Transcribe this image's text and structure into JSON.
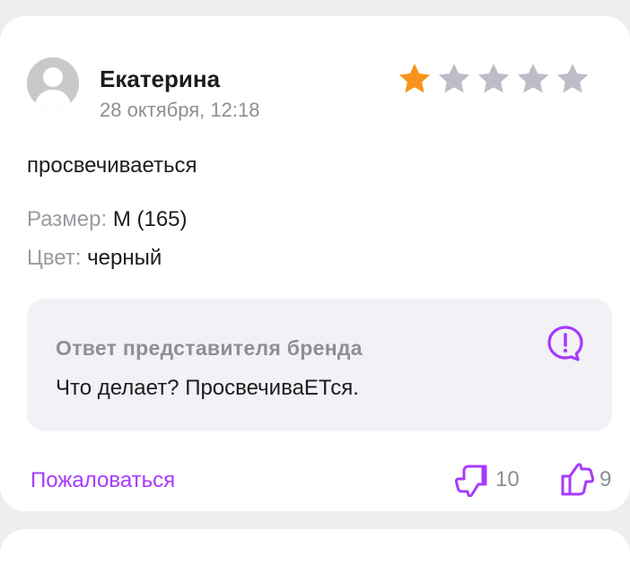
{
  "review": {
    "author": "Екатерина",
    "date": "28 октября, 12:18",
    "rating": 1,
    "rating_max": 5,
    "text": "просвечиваеться",
    "size_label": "Размер:",
    "size_value": "M (165)",
    "color_label": "Цвет:",
    "color_value": "черный"
  },
  "brand_reply": {
    "title": "Ответ представителя бренда",
    "text": "Что делает? ПросвечиваЕТся.",
    "icon": "exclamation-bubble-icon"
  },
  "footer": {
    "complain_label": "Пожаловаться",
    "dislikes": "10",
    "likes": "9"
  },
  "colors": {
    "accent": "#a73afd",
    "star_filled": "#f7941d",
    "star_empty": "#bdbdc7",
    "muted": "#8e8e93"
  }
}
